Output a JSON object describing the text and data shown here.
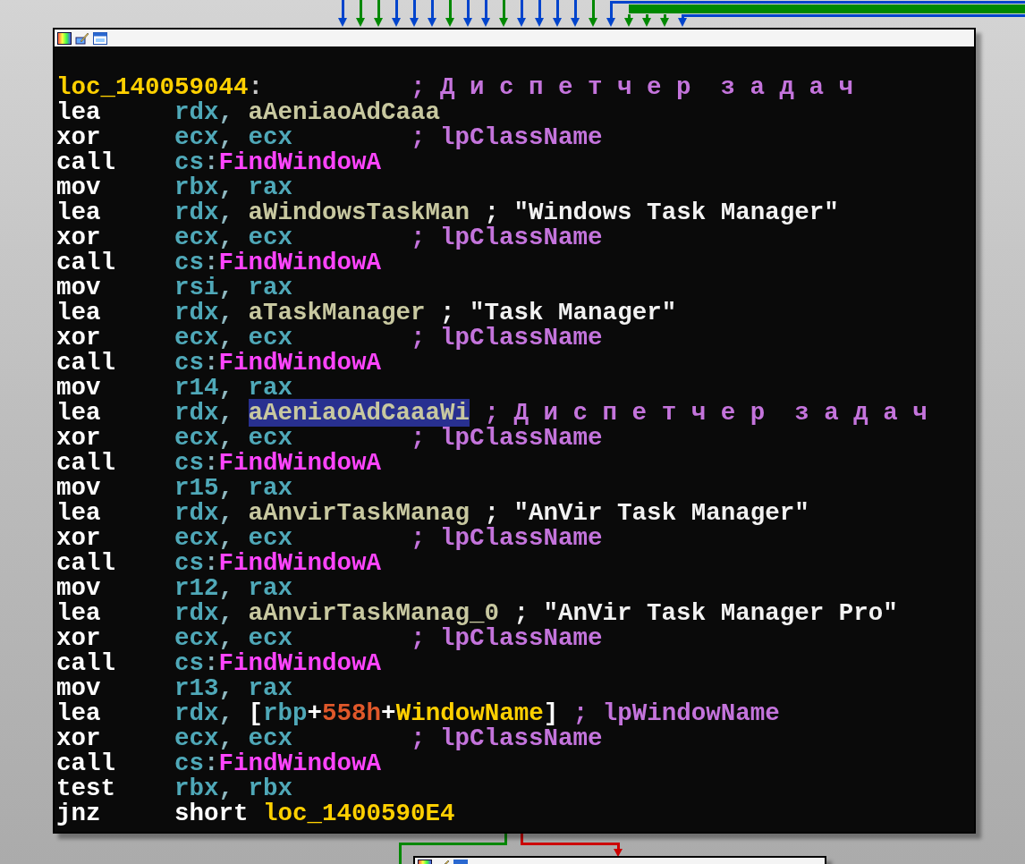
{
  "incoming_edges": [
    {
      "color": "#0044cc"
    },
    {
      "color": "#008800"
    },
    {
      "color": "#008800"
    },
    {
      "color": "#0044cc"
    },
    {
      "color": "#0044cc"
    },
    {
      "color": "#0044cc"
    },
    {
      "color": "#008800"
    },
    {
      "color": "#0044cc"
    },
    {
      "color": "#0044cc"
    },
    {
      "color": "#008800"
    },
    {
      "color": "#0044cc"
    },
    {
      "color": "#0044cc"
    },
    {
      "color": "#0044cc"
    },
    {
      "color": "#0044cc"
    },
    {
      "color": "#008800"
    },
    {
      "color": "#0044cc"
    },
    {
      "color": "#008800"
    },
    {
      "color": "#008800"
    },
    {
      "color": "#008800"
    },
    {
      "color": "#0044cc"
    }
  ],
  "outgoing_edges": [
    {
      "color": "#008800"
    },
    {
      "color": "#cc0000"
    }
  ],
  "lines": [
    {
      "kind": "label",
      "label": "loc_140059044",
      "suffix": ":",
      "comment": {
        "text": "; Д и с п е т ч е р  з а д а ч",
        "kind": "auto"
      }
    },
    {
      "kind": "instruction",
      "mnemonic": "lea",
      "operands": [
        {
          "text": "rdx",
          "kind": "register",
          "selected": false
        },
        {
          "text": ", ",
          "kind": "punct",
          "selected": false
        },
        {
          "text": "aAeniaoAdCaaa",
          "kind": "name",
          "selected": false
        }
      ]
    },
    {
      "kind": "instruction",
      "mnemonic": "xor",
      "operands": [
        {
          "text": "ecx",
          "kind": "register",
          "selected": false
        },
        {
          "text": ", ",
          "kind": "punct",
          "selected": false
        },
        {
          "text": "ecx",
          "kind": "register",
          "selected": false
        }
      ],
      "comment": {
        "text": "; lpClassName",
        "kind": "auto"
      }
    },
    {
      "kind": "instruction",
      "mnemonic": "call",
      "operands": [
        {
          "text": "cs",
          "kind": "register",
          "selected": false
        },
        {
          "text": ":",
          "kind": "punct",
          "selected": false
        },
        {
          "text": "FindWindowA",
          "kind": "import",
          "selected": false
        }
      ]
    },
    {
      "kind": "instruction",
      "mnemonic": "mov",
      "operands": [
        {
          "text": "rbx",
          "kind": "register",
          "selected": false
        },
        {
          "text": ", ",
          "kind": "punct",
          "selected": false
        },
        {
          "text": "rax",
          "kind": "register",
          "selected": false
        }
      ]
    },
    {
      "kind": "instruction",
      "mnemonic": "lea",
      "operands": [
        {
          "text": "rdx",
          "kind": "register",
          "selected": false
        },
        {
          "text": ", ",
          "kind": "punct",
          "selected": false
        },
        {
          "text": "aWindowsTaskMan",
          "kind": "name",
          "selected": false
        }
      ],
      "comment": {
        "text": "; \"Windows Task Manager\"",
        "kind": "string"
      }
    },
    {
      "kind": "instruction",
      "mnemonic": "xor",
      "operands": [
        {
          "text": "ecx",
          "kind": "register",
          "selected": false
        },
        {
          "text": ", ",
          "kind": "punct",
          "selected": false
        },
        {
          "text": "ecx",
          "kind": "register",
          "selected": false
        }
      ],
      "comment": {
        "text": "; lpClassName",
        "kind": "auto"
      }
    },
    {
      "kind": "instruction",
      "mnemonic": "call",
      "operands": [
        {
          "text": "cs",
          "kind": "register",
          "selected": false
        },
        {
          "text": ":",
          "kind": "punct",
          "selected": false
        },
        {
          "text": "FindWindowA",
          "kind": "import",
          "selected": false
        }
      ]
    },
    {
      "kind": "instruction",
      "mnemonic": "mov",
      "operands": [
        {
          "text": "rsi",
          "kind": "register",
          "selected": false
        },
        {
          "text": ", ",
          "kind": "punct",
          "selected": false
        },
        {
          "text": "rax",
          "kind": "register",
          "selected": false
        }
      ]
    },
    {
      "kind": "instruction",
      "mnemonic": "lea",
      "operands": [
        {
          "text": "rdx",
          "kind": "register",
          "selected": false
        },
        {
          "text": ", ",
          "kind": "punct",
          "selected": false
        },
        {
          "text": "aTaskManager",
          "kind": "name",
          "selected": false
        }
      ],
      "comment": {
        "text": "; \"Task Manager\"",
        "kind": "string"
      }
    },
    {
      "kind": "instruction",
      "mnemonic": "xor",
      "operands": [
        {
          "text": "ecx",
          "kind": "register",
          "selected": false
        },
        {
          "text": ", ",
          "kind": "punct",
          "selected": false
        },
        {
          "text": "ecx",
          "kind": "register",
          "selected": false
        }
      ],
      "comment": {
        "text": "; lpClassName",
        "kind": "auto"
      }
    },
    {
      "kind": "instruction",
      "mnemonic": "call",
      "operands": [
        {
          "text": "cs",
          "kind": "register",
          "selected": false
        },
        {
          "text": ":",
          "kind": "punct",
          "selected": false
        },
        {
          "text": "FindWindowA",
          "kind": "import",
          "selected": false
        }
      ]
    },
    {
      "kind": "instruction",
      "mnemonic": "mov",
      "operands": [
        {
          "text": "r14",
          "kind": "register",
          "selected": false
        },
        {
          "text": ", ",
          "kind": "punct",
          "selected": false
        },
        {
          "text": "rax",
          "kind": "register",
          "selected": false
        }
      ]
    },
    {
      "kind": "instruction",
      "mnemonic": "lea",
      "operands": [
        {
          "text": "rdx",
          "kind": "register",
          "selected": false
        },
        {
          "text": ", ",
          "kind": "punct",
          "selected": false
        },
        {
          "text": "aAeniaoAdCaaaWi",
          "kind": "name",
          "selected": true
        }
      ],
      "comment": {
        "text": "; Д и с п е т ч е р  з а д а ч",
        "kind": "auto"
      }
    },
    {
      "kind": "instruction",
      "mnemonic": "xor",
      "operands": [
        {
          "text": "ecx",
          "kind": "register",
          "selected": false
        },
        {
          "text": ", ",
          "kind": "punct",
          "selected": false
        },
        {
          "text": "ecx",
          "kind": "register",
          "selected": false
        }
      ],
      "comment": {
        "text": "; lpClassName",
        "kind": "auto"
      }
    },
    {
      "kind": "instruction",
      "mnemonic": "call",
      "operands": [
        {
          "text": "cs",
          "kind": "register",
          "selected": false
        },
        {
          "text": ":",
          "kind": "punct",
          "selected": false
        },
        {
          "text": "FindWindowA",
          "kind": "import",
          "selected": false
        }
      ]
    },
    {
      "kind": "instruction",
      "mnemonic": "mov",
      "operands": [
        {
          "text": "r15",
          "kind": "register",
          "selected": false
        },
        {
          "text": ", ",
          "kind": "punct",
          "selected": false
        },
        {
          "text": "rax",
          "kind": "register",
          "selected": false
        }
      ]
    },
    {
      "kind": "instruction",
      "mnemonic": "lea",
      "operands": [
        {
          "text": "rdx",
          "kind": "register",
          "selected": false
        },
        {
          "text": ", ",
          "kind": "punct",
          "selected": false
        },
        {
          "text": "aAnvirTaskManag",
          "kind": "name",
          "selected": false
        }
      ],
      "comment": {
        "text": "; \"AnVir Task Manager\"",
        "kind": "string"
      }
    },
    {
      "kind": "instruction",
      "mnemonic": "xor",
      "operands": [
        {
          "text": "ecx",
          "kind": "register",
          "selected": false
        },
        {
          "text": ", ",
          "kind": "punct",
          "selected": false
        },
        {
          "text": "ecx",
          "kind": "register",
          "selected": false
        }
      ],
      "comment": {
        "text": "; lpClassName",
        "kind": "auto"
      }
    },
    {
      "kind": "instruction",
      "mnemonic": "call",
      "operands": [
        {
          "text": "cs",
          "kind": "register",
          "selected": false
        },
        {
          "text": ":",
          "kind": "punct",
          "selected": false
        },
        {
          "text": "FindWindowA",
          "kind": "import",
          "selected": false
        }
      ]
    },
    {
      "kind": "instruction",
      "mnemonic": "mov",
      "operands": [
        {
          "text": "r12",
          "kind": "register",
          "selected": false
        },
        {
          "text": ", ",
          "kind": "punct",
          "selected": false
        },
        {
          "text": "rax",
          "kind": "register",
          "selected": false
        }
      ]
    },
    {
      "kind": "instruction",
      "mnemonic": "lea",
      "operands": [
        {
          "text": "rdx",
          "kind": "register",
          "selected": false
        },
        {
          "text": ", ",
          "kind": "punct",
          "selected": false
        },
        {
          "text": "aAnvirTaskManag_0",
          "kind": "name",
          "selected": false
        }
      ],
      "comment": {
        "text": "; \"AnVir Task Manager Pro\"",
        "kind": "string"
      }
    },
    {
      "kind": "instruction",
      "mnemonic": "xor",
      "operands": [
        {
          "text": "ecx",
          "kind": "register",
          "selected": false
        },
        {
          "text": ", ",
          "kind": "punct",
          "selected": false
        },
        {
          "text": "ecx",
          "kind": "register",
          "selected": false
        }
      ],
      "comment": {
        "text": "; lpClassName",
        "kind": "auto"
      }
    },
    {
      "kind": "instruction",
      "mnemonic": "call",
      "operands": [
        {
          "text": "cs",
          "kind": "register",
          "selected": false
        },
        {
          "text": ":",
          "kind": "punct",
          "selected": false
        },
        {
          "text": "FindWindowA",
          "kind": "import",
          "selected": false
        }
      ]
    },
    {
      "kind": "instruction",
      "mnemonic": "mov",
      "operands": [
        {
          "text": "r13",
          "kind": "register",
          "selected": false
        },
        {
          "text": ", ",
          "kind": "punct",
          "selected": false
        },
        {
          "text": "rax",
          "kind": "register",
          "selected": false
        }
      ]
    },
    {
      "kind": "instruction",
      "mnemonic": "lea",
      "operands": [
        {
          "text": "rdx",
          "kind": "register",
          "selected": false
        },
        {
          "text": ", ",
          "kind": "punct",
          "selected": false
        },
        {
          "text": "[",
          "kind": "plain",
          "selected": false
        },
        {
          "text": "rbp",
          "kind": "register",
          "selected": false
        },
        {
          "text": "+",
          "kind": "plain",
          "selected": false
        },
        {
          "text": "558h",
          "kind": "number",
          "selected": false
        },
        {
          "text": "+",
          "kind": "plain",
          "selected": false
        },
        {
          "text": "WindowName",
          "kind": "label",
          "selected": false
        },
        {
          "text": "]",
          "kind": "plain",
          "selected": false
        }
      ],
      "comment": {
        "text": "; lpWindowName",
        "kind": "auto"
      }
    },
    {
      "kind": "instruction",
      "mnemonic": "xor",
      "operands": [
        {
          "text": "ecx",
          "kind": "register",
          "selected": false
        },
        {
          "text": ", ",
          "kind": "punct",
          "selected": false
        },
        {
          "text": "ecx",
          "kind": "register",
          "selected": false
        }
      ],
      "comment": {
        "text": "; lpClassName",
        "kind": "auto"
      }
    },
    {
      "kind": "instruction",
      "mnemonic": "call",
      "operands": [
        {
          "text": "cs",
          "kind": "register",
          "selected": false
        },
        {
          "text": ":",
          "kind": "punct",
          "selected": false
        },
        {
          "text": "FindWindowA",
          "kind": "import",
          "selected": false
        }
      ]
    },
    {
      "kind": "instruction",
      "mnemonic": "test",
      "operands": [
        {
          "text": "rbx",
          "kind": "register",
          "selected": false
        },
        {
          "text": ", ",
          "kind": "punct",
          "selected": false
        },
        {
          "text": "rbx",
          "kind": "register",
          "selected": false
        }
      ]
    },
    {
      "kind": "instruction",
      "mnemonic": "jnz",
      "operands": [
        {
          "text": "short ",
          "kind": "plain",
          "selected": false
        },
        {
          "text": "loc_1400590E4",
          "kind": "label",
          "selected": false
        }
      ]
    }
  ]
}
